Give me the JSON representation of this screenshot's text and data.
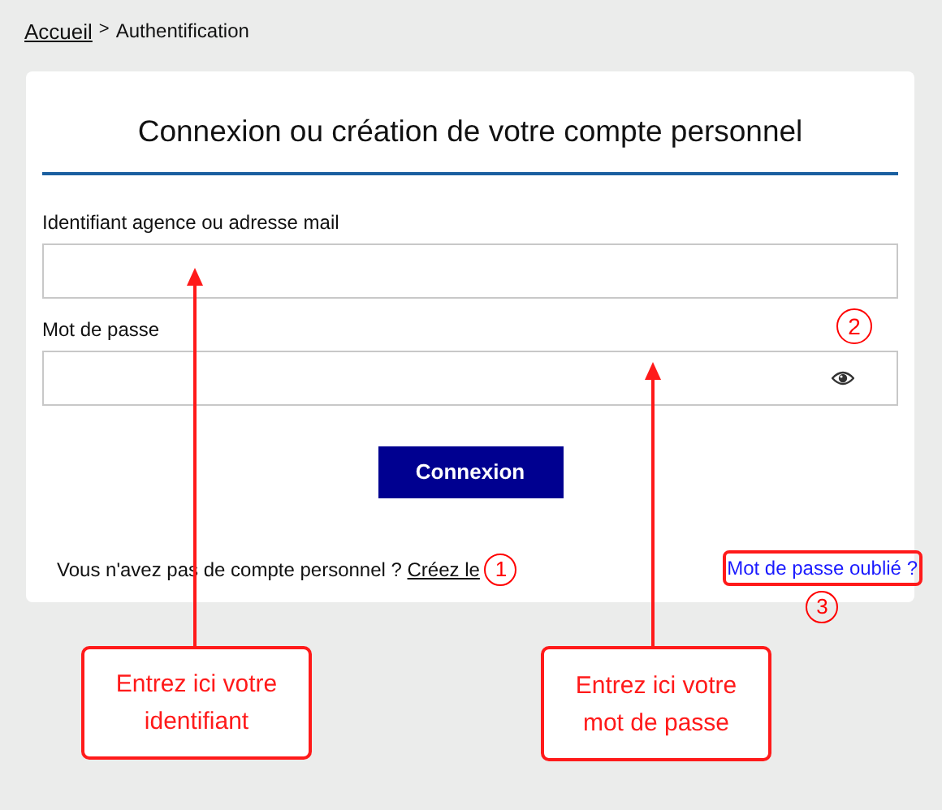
{
  "breadcrumb": [
    {
      "label": "Accueil",
      "kind": "link"
    },
    {
      "label": ">",
      "kind": "separator"
    },
    {
      "label": "Authentification",
      "kind": "current"
    }
  ],
  "title": "Connexion ou création de votre compte personnel",
  "fields": [
    {
      "label": "Identifiant agence ou adresse mail",
      "kind": "text"
    },
    {
      "label": "Mot de passe",
      "kind": "password"
    }
  ],
  "submit_button": "Connexion",
  "signup": {
    "text": "Vous n'avez pas de compte personnel ?",
    "link": "Créez le"
  },
  "forgot_link": "Mot de passe oublié ?",
  "annotation_markers": [
    "1",
    "2",
    "3"
  ],
  "callouts": [
    "Entrez ici votre identifiant",
    "Entrez ici votre mot de passe"
  ]
}
